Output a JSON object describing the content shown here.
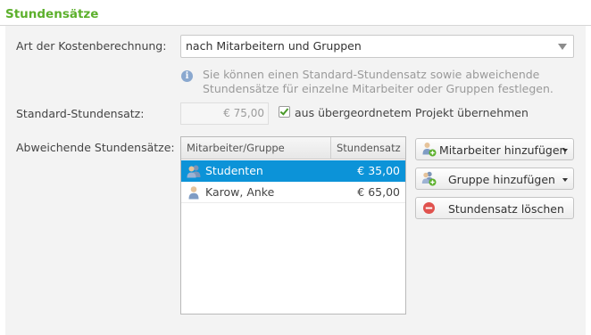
{
  "section_title": "Stundensätze",
  "cost_method": {
    "label": "Art der Kostenberechnung:",
    "selected": "nach Mitarbeitern und Gruppen"
  },
  "info_text": "Sie können einen Standard-Stundensatz sowie abweichende Stundensätze für einzelne Mitarbeiter oder Gruppen festlegen.",
  "standard_rate": {
    "label": "Standard-Stundensatz:",
    "value": "€ 75,00",
    "inherit_label": "aus übergeordnetem Projekt übernehmen",
    "inherit_checked": true
  },
  "deviating": {
    "label": "Abweichende Stundensätze:",
    "columns": [
      "Mitarbeiter/Gruppe",
      "Stundensatz"
    ],
    "rows": [
      {
        "name": "Studenten",
        "rate": "€ 35,00",
        "type": "group-icon",
        "selected": true
      },
      {
        "name": "Karow, Anke",
        "rate": "€ 65,00",
        "type": "user-icon",
        "selected": false
      }
    ]
  },
  "buttons": {
    "add_employee": "Mitarbeiter hinzufügen",
    "add_group": "Gruppe hinzufügen",
    "delete_rate": "Stundensatz löschen"
  },
  "colors": {
    "accent": "#5cb02c",
    "selection": "#0c93d8"
  }
}
